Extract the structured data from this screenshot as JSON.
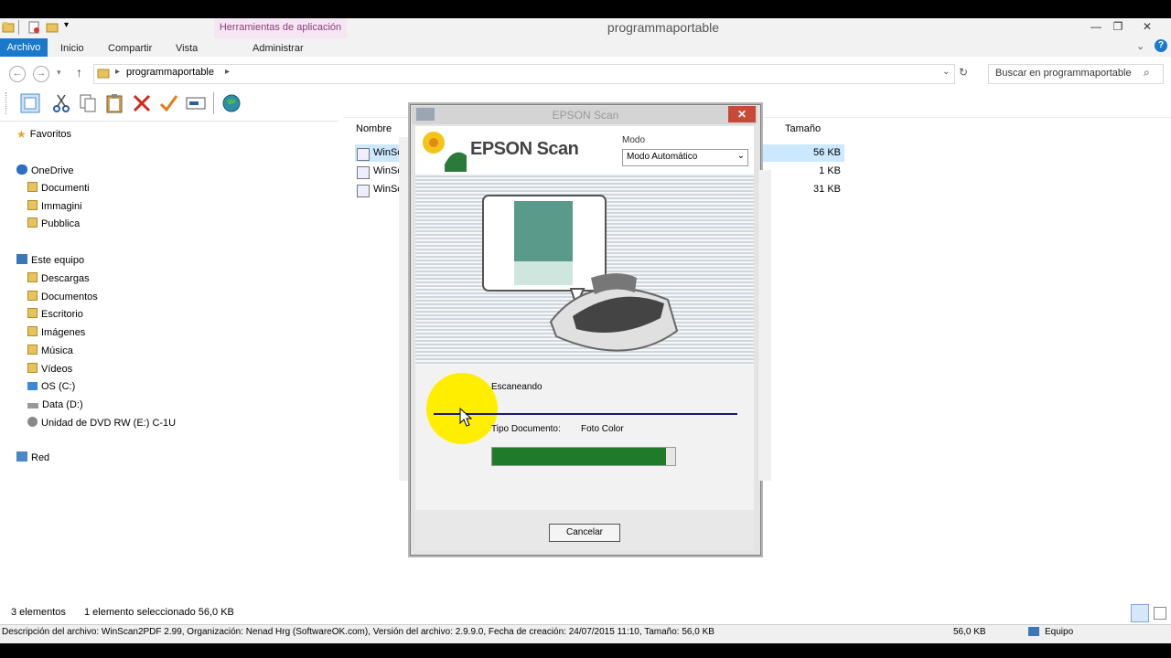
{
  "window": {
    "title": "programmaportable",
    "tools_tab": "Herramientas de aplicación",
    "tabs": [
      "Archivo",
      "Inicio",
      "Compartir",
      "Vista",
      "Administrar"
    ]
  },
  "address": {
    "path": "programmaportable",
    "search_placeholder": "Buscar en programmaportable"
  },
  "nav": {
    "favorites": "Favoritos",
    "onedrive": "OneDrive",
    "onedrive_items": [
      "Documenti",
      "Immagini",
      "Pubblica"
    ],
    "this_pc": "Este equipo",
    "pc_items": [
      "Descargas",
      "Documentos",
      "Escritorio",
      "Imágenes",
      "Música",
      "Vídeos",
      "OS (C:)",
      "Data (D:)",
      "Unidad de DVD RW (E:) C-1U"
    ],
    "network": "Red"
  },
  "files": {
    "col_name": "Nombre",
    "col_size": "Tamaño",
    "rows": [
      {
        "name": "WinScan",
        "size": "56 KB"
      },
      {
        "name": "WinScan",
        "size": "1 KB"
      },
      {
        "name": "WinSc",
        "size": "31 KB"
      }
    ]
  },
  "dialog": {
    "title": "EPSON Scan",
    "brand": "EPSON Scan",
    "mode_label": "Modo",
    "mode_value": "Modo Automático",
    "status": "Escaneando",
    "doc_type_label": "Tipo Documento:",
    "doc_type_value": "Foto Color",
    "progress": 0.95,
    "cancel_label": "Cancelar"
  },
  "status": {
    "items_count": "3 elementos",
    "selection": "1 elemento seleccionado  56,0 KB"
  },
  "description_bar": {
    "text": "Descripción del archivo: WinScan2PDF 2.99, Organización: Nenad Hrg (SoftwareOK.com), Versión del archivo: 2.9.9.0, Fecha de creación: 24/07/2015 11:10, Tamaño: 56,0 KB",
    "size": "56,0 KB",
    "computer": "Equipo"
  },
  "colors": {
    "accent": "#1979ca",
    "progress": "#1f7a2a",
    "cursor_highlight": "#ffee00"
  }
}
